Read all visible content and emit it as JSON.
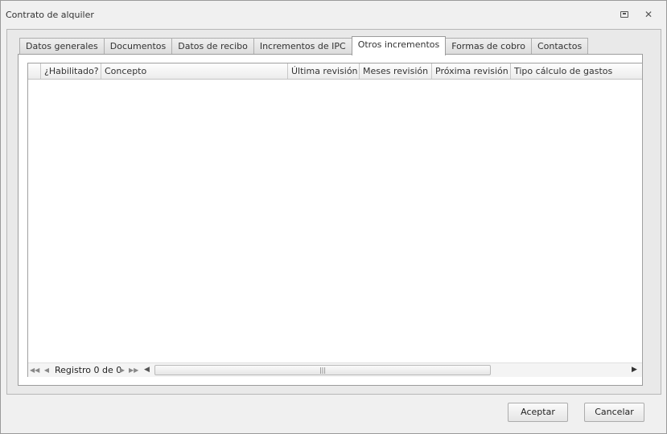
{
  "window": {
    "title": "Contrato de alquiler"
  },
  "tabs": [
    {
      "label": "Datos generales",
      "active": false
    },
    {
      "label": "Documentos",
      "active": false
    },
    {
      "label": "Datos de recibo",
      "active": false
    },
    {
      "label": "Incrementos de IPC",
      "active": false
    },
    {
      "label": "Otros incrementos",
      "active": true
    },
    {
      "label": "Formas de cobro",
      "active": false
    },
    {
      "label": "Contactos",
      "active": false
    }
  ],
  "grid": {
    "columns": [
      {
        "label": ""
      },
      {
        "label": "¿Habilitado?"
      },
      {
        "label": "Concepto"
      },
      {
        "label": "Última revisión"
      },
      {
        "label": "Meses revisión"
      },
      {
        "label": "Próxima revisión"
      },
      {
        "label": "Tipo cálculo de gastos"
      }
    ],
    "rows": [],
    "navigator": {
      "record_label": "Registro 0 de 0"
    }
  },
  "buttons": {
    "accept": "Aceptar",
    "cancel": "Cancelar"
  }
}
